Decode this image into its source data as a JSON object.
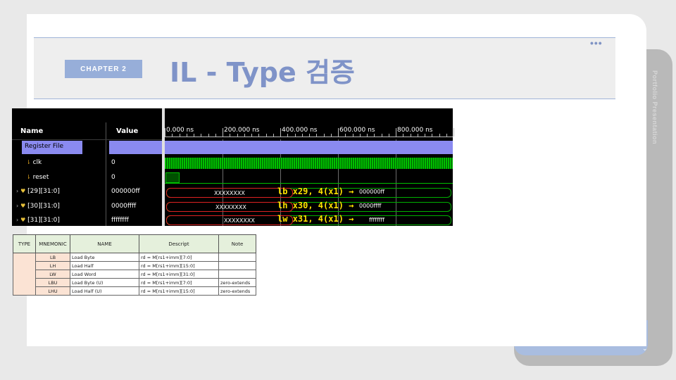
{
  "slide": {
    "chapter": "CHAPTER 2",
    "title": "IL - Type 검증",
    "side_text": "Portfolio Presentation",
    "more_dots": "•••"
  },
  "waveform": {
    "name_header": "Name",
    "value_header": "Value",
    "signals": [
      {
        "name": "Register File",
        "value": ""
      },
      {
        "name": "clk",
        "value": "0"
      },
      {
        "name": "reset",
        "value": "0"
      },
      {
        "name": "[29][31:0]",
        "value": "000000ff"
      },
      {
        "name": "[30][31:0]",
        "value": "0000ffff"
      },
      {
        "name": "[31][31:0]",
        "value": "ffffffff"
      }
    ],
    "time_ticks": [
      "0.000 ns",
      "200.000 ns",
      "400.000 ns",
      "600.000 ns",
      "800.000 ns"
    ],
    "bus_placeholder": "XXXXXXXX",
    "annotations": [
      "lb x29, 4(x1) →",
      "lh x30, 4(x1) →",
      "lw x31, 4(x1) →"
    ],
    "bus_values": [
      "000000ff",
      "0000ffff",
      "ffffffff"
    ]
  },
  "instruction_table": {
    "headers": [
      "TYPE",
      "MNEMONIC",
      "NAME",
      "Descript",
      "Note"
    ],
    "rows": [
      {
        "mnemonic": "LB",
        "name": "Load  Byte",
        "descript": "rd = M[rs1+imm][7:0]",
        "note": ""
      },
      {
        "mnemonic": "LH",
        "name": "Load  Half",
        "descript": "rd = M[rs1+imm][15:0]",
        "note": ""
      },
      {
        "mnemonic": "LW",
        "name": "Load  Word",
        "descript": "rd = M[rs1+imm][31:0]",
        "note": ""
      },
      {
        "mnemonic": "LBU",
        "name": "Load Byte (U)",
        "descript": "rd = M[rs1+imm][7:0]",
        "note": "zero-extends"
      },
      {
        "mnemonic": "LHU",
        "name": "Load Half (U)",
        "descript": "rd = M[rs1+imm][15:0]",
        "note": "zero-extends"
      }
    ]
  }
}
